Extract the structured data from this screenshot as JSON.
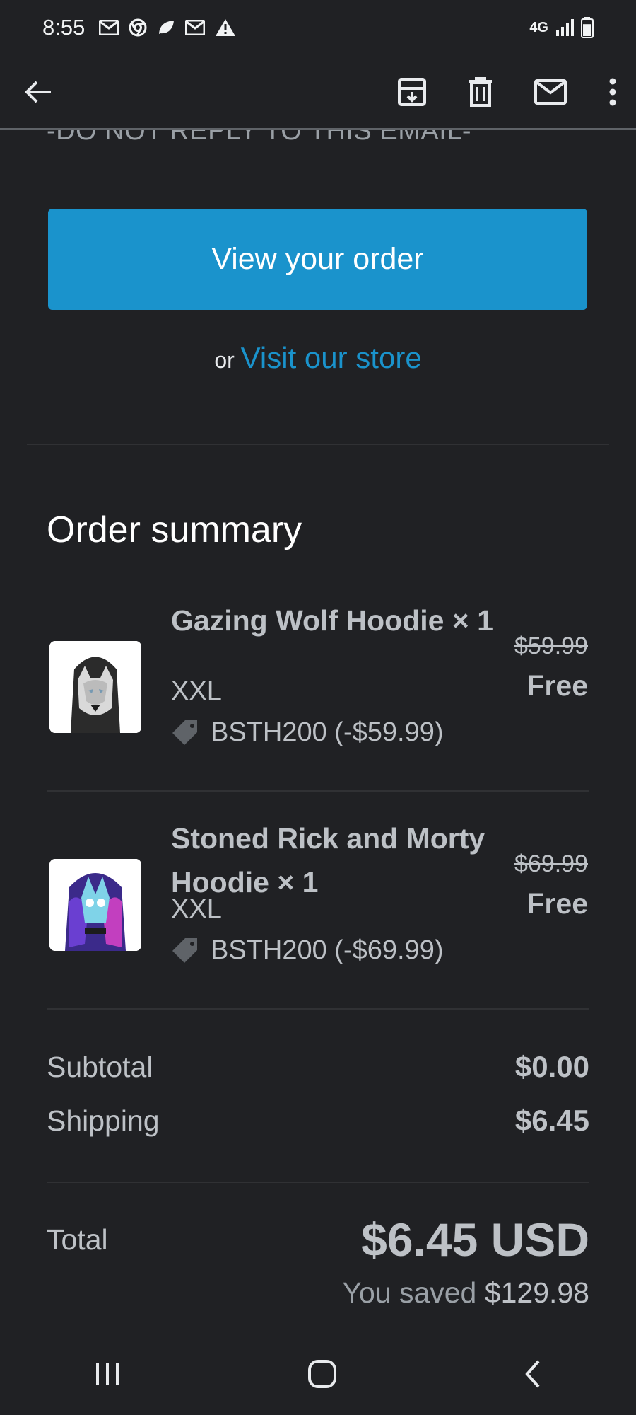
{
  "status_bar": {
    "time": "8:55",
    "left_icons": [
      "gmail-icon",
      "chrome-icon",
      "leaf-icon",
      "gmail-icon",
      "warning-icon"
    ],
    "network": "4G",
    "battery_level": 0.7
  },
  "app_bar": {
    "back_icon": "arrow-left-icon",
    "actions": [
      "archive-icon",
      "trash-icon",
      "mail-icon",
      "more-vertical-icon"
    ]
  },
  "email": {
    "no_reply_text": "-DO NOT REPLY TO THIS EMAIL-",
    "view_order_label": "View your order",
    "or_text": "or",
    "visit_store_label": "Visit our store",
    "accent_color": "#1a93cc"
  },
  "summary": {
    "title": "Order summary",
    "items": [
      {
        "name": "Gazing Wolf Hoodie × 1",
        "variant": "XXL",
        "discount": "BSTH200 (-$59.99)",
        "price_original": "$59.99",
        "price_final": "Free"
      },
      {
        "name": "Stoned Rick and Morty Hoodie × 1",
        "variant": "XXL",
        "discount": "BSTH200 (-$69.99)",
        "price_original": "$69.99",
        "price_final": "Free"
      }
    ],
    "subtotal_label": "Subtotal",
    "subtotal_value": "$0.00",
    "shipping_label": "Shipping",
    "shipping_value": "$6.45",
    "total_label": "Total",
    "total_value": "$6.45 USD",
    "saved_label": "You saved",
    "saved_value": "$129.98"
  },
  "nav_bar": {
    "buttons": [
      "recents-icon",
      "home-icon",
      "back-icon"
    ]
  }
}
